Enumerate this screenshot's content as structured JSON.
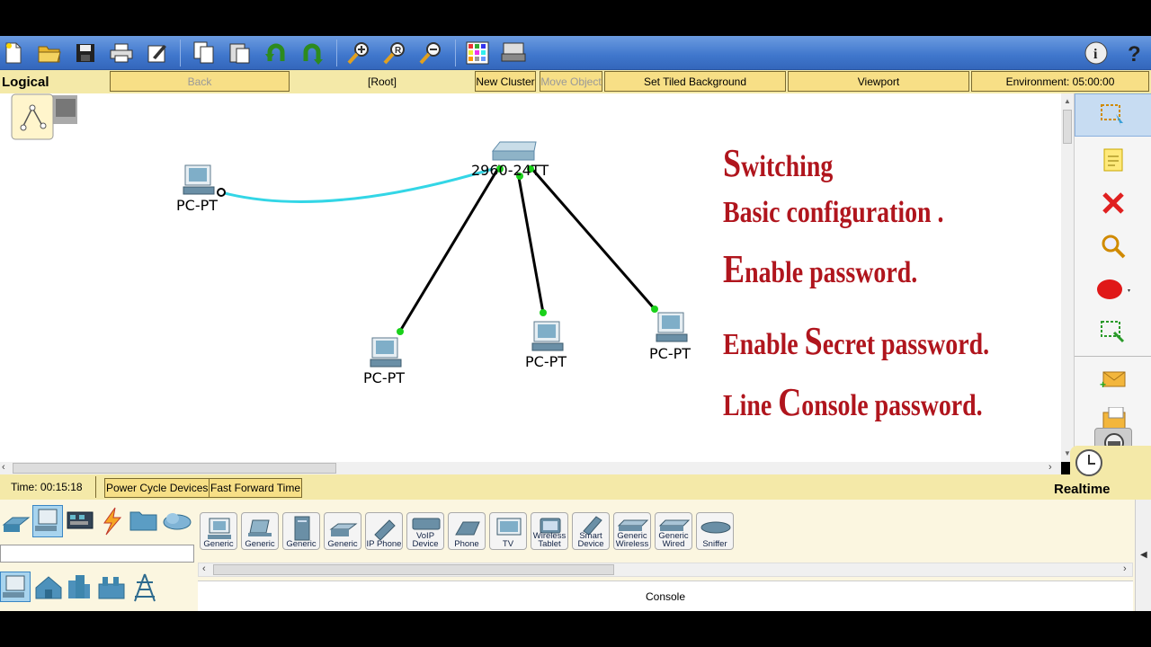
{
  "nav": {
    "mode": "Logical",
    "back": "Back",
    "root": "[Root]",
    "new_cluster": "New Cluster",
    "move_object": "Move Object",
    "set_tiled_background": "Set Tiled Background",
    "viewport": "Viewport",
    "environment": "Environment: 05:00:00"
  },
  "canvas": {
    "switch_label": "2960-24TT",
    "pc_labels": [
      "PC-PT",
      "PC-PT",
      "PC-PT",
      "PC-PT"
    ],
    "overlay": {
      "line1_cap": "S",
      "line1_rest": "witching",
      "line2": "Basic configuration .",
      "line3_cap": "E",
      "line3_rest": "nable password.",
      "line4_a": "Enable ",
      "line4_cap": "S",
      "line4_rest": "ecret password.",
      "line5_a": "Line ",
      "line5_cap": "C",
      "line5_rest": "onsole password."
    }
  },
  "status": {
    "time": "Time: 00:15:18",
    "power_cycle": "Power Cycle Devices",
    "fast_forward": "Fast Forward Time",
    "mode": "Realtime"
  },
  "devices": [
    "Generic",
    "Generic",
    "Generic",
    "Generic",
    "IP Phone",
    "VoIP Device",
    "Phone",
    "TV",
    "Wireless Tablet",
    "Smart Device",
    "Generic Wireless",
    "Generic Wired",
    "Sniffer"
  ],
  "console_label": "Console",
  "colors": {
    "toolbar_blue": "#3f76cc",
    "nav_yellow": "#f4e9a8",
    "overlay_red": "#b0151d",
    "link_cyan": "#33d6e6",
    "link_green": "#1ad11a"
  }
}
